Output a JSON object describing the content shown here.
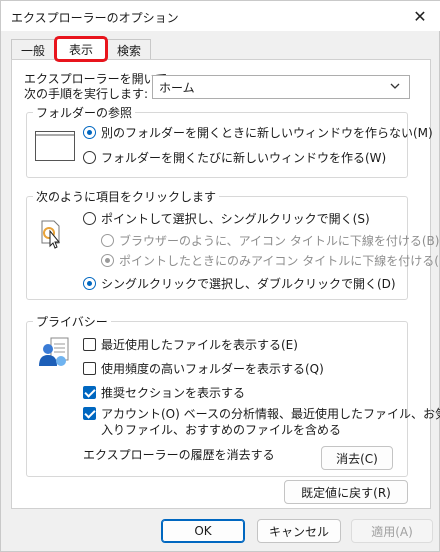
{
  "window": {
    "title": "エクスプローラーのオプション",
    "close_glyph": "✕"
  },
  "tabs": [
    {
      "label": "一般",
      "active": false
    },
    {
      "label": "表示",
      "active": true
    },
    {
      "label": "検索",
      "active": false
    }
  ],
  "open_with": {
    "label_line1": "エクスプローラーを開いて、",
    "label_line2": "次の手順を実行します:",
    "selected": "ホーム"
  },
  "folder_browse": {
    "title": "フォルダーの参照",
    "options": [
      {
        "label": "別のフォルダーを開くときに新しいウィンドウを作らない(M)",
        "checked": true
      },
      {
        "label": "フォルダーを開くたびに新しいウィンドウを作る(W)",
        "checked": false
      }
    ]
  },
  "click_items": {
    "title": "次のように項目をクリックします",
    "single_click": "ポイントして選択し、シングルクリックで開く(S)",
    "underline_browser": "ブラウザーのように、アイコン タイトルに下線を付ける(B)",
    "underline_point": "ポイントしたときにのみアイコン タイトルに下線を付ける(P)",
    "double_click": "シングルクリックで選択し、ダブルクリックで開く(D)"
  },
  "privacy": {
    "title": "プライバシー",
    "recent_files": "最近使用したファイルを表示する(E)",
    "frequent_folders": "使用頻度の高いフォルダーを表示する(Q)",
    "recommended": "推奨セクションを表示する",
    "account_line1": "アカウント(O) ベースの分析情報、最近使用したファイル、お気に",
    "account_line2": "入りファイル、おすすめのファイルを含める",
    "clear_history_label": "エクスプローラーの履歴を消去する",
    "clear_button": "消去(C)"
  },
  "restore_defaults": "既定値に戻す(R)",
  "footer": {
    "ok": "OK",
    "cancel": "キャンセル",
    "apply": "適用(A)"
  },
  "colors": {
    "accent": "#0067c0",
    "highlight": "#e8141c"
  }
}
